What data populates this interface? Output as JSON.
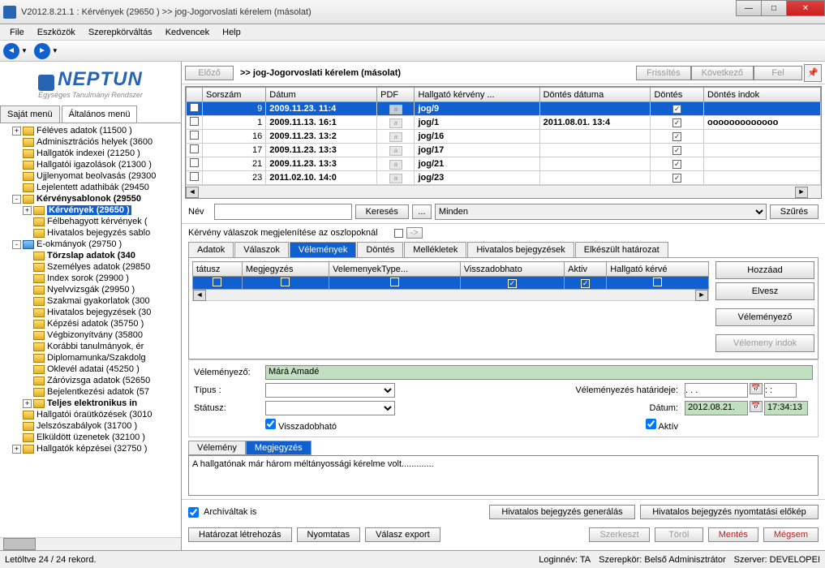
{
  "window": {
    "title": "V2012.8.21.1 : Kérvények (29650 )  >> jog-Jogorvoslati kérelem (másolat)"
  },
  "menubar": [
    "File",
    "Eszközök",
    "Szerepkörváltás",
    "Kedvencek",
    "Help"
  ],
  "logo": {
    "title": "NEPTUN",
    "subtitle": "Egységes Tanulmányi Rendszer"
  },
  "left_tabs": {
    "t1": "Saját menü",
    "t2": "Általános menü"
  },
  "tree": [
    {
      "depth": 1,
      "exp": "+",
      "label": "Féléves adatok (11500  )"
    },
    {
      "depth": 1,
      "exp": "",
      "label": "Adminisztrációs helyek (3600"
    },
    {
      "depth": 1,
      "exp": "",
      "label": "Hallgatók indexei (21250  )"
    },
    {
      "depth": 1,
      "exp": "",
      "label": "Hallgatói igazolások (21300  )"
    },
    {
      "depth": 1,
      "exp": "",
      "label": "Ujjlenyomat beolvasás (29300"
    },
    {
      "depth": 1,
      "exp": "",
      "label": "Lejelentett adathibák (29450"
    },
    {
      "depth": 1,
      "exp": "-",
      "bold": true,
      "label": "Kérvénysablonok (29550"
    },
    {
      "depth": 2,
      "exp": "+",
      "sel": true,
      "bold": true,
      "label": "Kérvények  (29650  )"
    },
    {
      "depth": 2,
      "exp": "",
      "label": "Félbehagyott kérvények ("
    },
    {
      "depth": 2,
      "exp": "",
      "label": "Hivatalos bejegyzés sablo"
    },
    {
      "depth": 1,
      "exp": "-",
      "folder": true,
      "label": "E-okmányok (29750  )"
    },
    {
      "depth": 2,
      "exp": "",
      "bold": true,
      "label": "Törzslap adatok (340"
    },
    {
      "depth": 2,
      "exp": "",
      "label": "Személyes adatok (29850"
    },
    {
      "depth": 2,
      "exp": "",
      "label": "Index sorok (29900  )"
    },
    {
      "depth": 2,
      "exp": "",
      "label": "Nyelvvizsgák (29950  )"
    },
    {
      "depth": 2,
      "exp": "",
      "label": "Szakmai gyakorlatok (300"
    },
    {
      "depth": 2,
      "exp": "",
      "label": "Hivatalos bejegyzések (30"
    },
    {
      "depth": 2,
      "exp": "",
      "label": "Képzési adatok (35750  )"
    },
    {
      "depth": 2,
      "exp": "",
      "label": "Végbizonyítvány (35800"
    },
    {
      "depth": 2,
      "exp": "",
      "label": "Korábbi tanulmányok, ér"
    },
    {
      "depth": 2,
      "exp": "",
      "label": "Diplomamunka/Szakdolg"
    },
    {
      "depth": 2,
      "exp": "",
      "label": "Oklevél adatai (45250  )"
    },
    {
      "depth": 2,
      "exp": "",
      "label": "Záróvizsga adatok (52650"
    },
    {
      "depth": 2,
      "exp": "",
      "label": "Bejelentkezési adatok (57"
    },
    {
      "depth": 2,
      "exp": "+",
      "bold": true,
      "label": "Teljes elektronikus in"
    },
    {
      "depth": 1,
      "exp": "",
      "label": "Hallgatói óraütközések (3010"
    },
    {
      "depth": 1,
      "exp": "",
      "label": "Jelszószabályok (31700  )"
    },
    {
      "depth": 1,
      "exp": "",
      "label": "Elküldött üzenetek (32100  )"
    },
    {
      "depth": 1,
      "exp": "+",
      "label": "Hallgatók képzései (32750  )"
    }
  ],
  "top_buttons": {
    "prev": "Előző",
    "title": ">> jog-Jogorvoslati kérelem (másolat)",
    "refresh": "Frissítés",
    "next": "Következő",
    "up": "Fel"
  },
  "grid": {
    "headers": [
      "",
      "Sorszám",
      "Dátum",
      "PDF",
      "Hallgató kérvény ...",
      "Döntés dátuma",
      "Döntés",
      "Döntés indok"
    ],
    "rows": [
      {
        "sel": true,
        "sor": "9",
        "datum": "2009.11.23. 11:4",
        "hk": "jog/9",
        "dd": "",
        "dontes": true,
        "di": ""
      },
      {
        "sor": "1",
        "datum": "2009.11.13. 16:1",
        "hk": "jog/1",
        "dd": "2011.08.01. 13:4",
        "dontes": true,
        "di": "ooooooooooooo"
      },
      {
        "sor": "16",
        "datum": "2009.11.23. 13:2",
        "hk": "jog/16",
        "dd": "",
        "dontes": true,
        "di": ""
      },
      {
        "sor": "17",
        "datum": "2009.11.23. 13:3",
        "hk": "jog/17",
        "dd": "",
        "dontes": true,
        "di": ""
      },
      {
        "sor": "21",
        "datum": "2009.11.23. 13:3",
        "hk": "jog/21",
        "dd": "",
        "dontes": true,
        "di": ""
      },
      {
        "sor": "23",
        "datum": "2011.02.10. 14:0",
        "hk": "jog/23",
        "dd": "",
        "dontes": true,
        "di": ""
      }
    ]
  },
  "search": {
    "name_label": "Név",
    "name_value": "",
    "search_btn": "Keresés",
    "more_btn": "...",
    "filter_sel": "Minden",
    "filter_btn": "Szűrés"
  },
  "section": {
    "label": "Kérvény válaszok megjelenítése az oszlopoknál"
  },
  "detail_tabs": [
    "Adatok",
    "Válaszok",
    "Vélemények",
    "Döntés",
    "Mellékletek",
    "Hivatalos bejegyzések",
    "Elkészült határozat"
  ],
  "detail_tabs_active": 2,
  "inner_headers": [
    "tátusz",
    "Megjegyzés",
    "VelemenyekType...",
    "Visszadobhato",
    "Aktiv",
    "Hallgató kérvé"
  ],
  "inner_row_checks": [
    false,
    false,
    false,
    true,
    true,
    false
  ],
  "side_buttons": {
    "add": "Hozzáad",
    "remove": "Elvesz",
    "reviewer": "Véleményező",
    "reason": "Vélemeny indok"
  },
  "form": {
    "reviewer_label": "Véleményező:",
    "reviewer_value": "Márá Amadé",
    "type_label": "Típus :",
    "type_value": "",
    "deadline_label": "Véleményezés határideje:",
    "deadline_value": ". . .",
    "status_label": "Státusz:",
    "status_value": "",
    "date_label": "Dátum:",
    "date_value": "2012.08.21.",
    "time_value": "17:34:13",
    "throwback_label": "Visszadobható",
    "active_label": "Aktív"
  },
  "memo_tabs": {
    "t1": "Vélemény",
    "t2": "Megjegyzés"
  },
  "memo_text": "A hallgatónak már három méltányossági kérelme volt.............",
  "bottom": {
    "archive": "Archíváltak is",
    "gen": "Hivatalos bejegyzés generálás",
    "preview": "Hivatalos bejegyzés nyomtatási előkép",
    "hataroz": "Határozat létrehozás",
    "print": "Nyomtatas",
    "export": "Válasz export",
    "edit": "Szerkeszt",
    "delete": "Töröl",
    "save": "Mentés",
    "cancel": "Mégsem"
  },
  "status": {
    "left": "Letöltve 24 / 24 rekord.",
    "login": "Loginnév: TA",
    "role": "Szerepkör: Belső Adminisztrátor",
    "server": "Szerver: DEVELOPEI"
  }
}
